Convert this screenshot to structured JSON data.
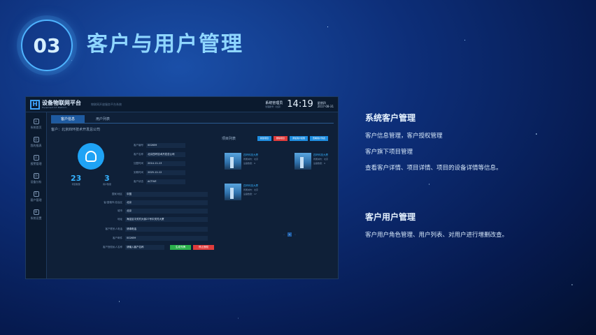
{
  "section": {
    "number": "03",
    "title": "客户与用户管理"
  },
  "app": {
    "logo_mark": "H",
    "logo_text": "设备物联网平台",
    "logo_sub": "Equipment IoT Platform",
    "subtitle": "物联网开放服务平台系统",
    "user_name": "系统管理员",
    "user_sub": "管理账号（北京）",
    "clock": "14:19",
    "date_day": "星期四",
    "date": "2017-08-31",
    "sidebar": [
      {
        "label": "系统首页",
        "icon": "⌂"
      },
      {
        "label": "我的报表",
        "icon": "◎"
      },
      {
        "label": "报警管理",
        "icon": "⚠"
      },
      {
        "label": "设备分析",
        "icon": "◷"
      },
      {
        "label": "客户管理",
        "icon": "⚲"
      },
      {
        "label": "系统设置",
        "icon": "⚙"
      }
    ],
    "tabs": [
      {
        "label": "客户信息"
      },
      {
        "label": "用户列表"
      }
    ],
    "company": "客户：北京四环技术开发总公司",
    "stats": [
      {
        "n": "23",
        "l": "项目数量"
      },
      {
        "n": "3",
        "l": "用户数量"
      }
    ],
    "kv": [
      {
        "k": "客户编号",
        "v": "002659"
      },
      {
        "k": "客户名称",
        "v": "北京四环技术开发总公司"
      },
      {
        "k": "加盟时间",
        "v": "2014-11-13"
      },
      {
        "k": "到期时间",
        "v": "2025-12-12"
      },
      {
        "k": "客户状态",
        "v": "ACTIVE"
      }
    ],
    "fields": [
      {
        "k": "国家/地区",
        "v": "中国"
      },
      {
        "k": "省/直辖市/自治区",
        "v": "北京"
      },
      {
        "k": "城市",
        "v": "北京"
      },
      {
        "k": "地址",
        "v": "海淀区中关村大街27号中关村大厦"
      },
      {
        "k": "客户联系人电话",
        "v": "请填电话"
      },
      {
        "k": "客户邮件",
        "v": "002659"
      },
      {
        "k": "客户授权私人名称",
        "v": "请输入客户名称"
      }
    ],
    "btn_ok": "生成令牌",
    "btn_del": "停止授权",
    "proj_title": "项目列表",
    "proj_btns": [
      {
        "label": "新建项目"
      },
      {
        "label": "删除项目"
      },
      {
        "label": "添加用户权限"
      },
      {
        "label": "查看用户列表"
      }
    ],
    "cards": [
      {
        "title": "四环科技大厦",
        "l1": "所属城市：北京",
        "l2": "设备数量：9"
      },
      {
        "title": "四环科技大厦",
        "l1": "所属城市：北京",
        "l2": "设备数量：9"
      },
      {
        "title": "四环科技大厦",
        "l1": "所属城市：北京",
        "l2": "设备数量：17"
      }
    ],
    "pager": [
      "‹",
      "1",
      "›"
    ]
  },
  "panels": [
    {
      "head": "系统客户管理",
      "lines": [
        "客户信息管理，客户授权管理",
        "客户旗下项目管理",
        "查看客户详情、项目详情、项目的设备详情等信息。"
      ]
    },
    {
      "head": "客户用户管理",
      "lines": [
        "客户用户角色管理、用户列表、对用户进行增删改查。"
      ]
    }
  ],
  "colors": {
    "accent": "#35b2ff",
    "ok": "#2bb24c",
    "danger": "#e03c3c",
    "title": "#8fd6ff"
  }
}
